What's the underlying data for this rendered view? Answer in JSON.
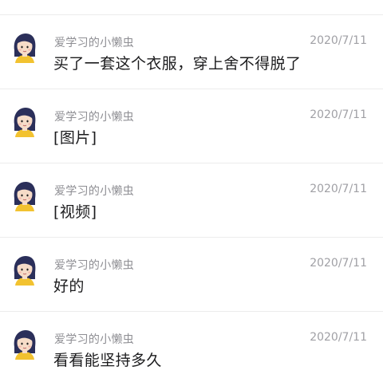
{
  "messages": [
    {
      "sender": "爱学习的小懒虫",
      "time": "2020/7/11",
      "text": "买了一套这个衣服，穿上舍不得脱了",
      "avatar_icon": "girl-avatar-icon"
    },
    {
      "sender": "爱学习的小懒虫",
      "time": "2020/7/11",
      "text": "[图片]",
      "avatar_icon": "girl-avatar-icon"
    },
    {
      "sender": "爱学习的小懒虫",
      "time": "2020/7/11",
      "text": "[视频]",
      "avatar_icon": "girl-avatar-icon"
    },
    {
      "sender": "爱学习的小懒虫",
      "time": "2020/7/11",
      "text": "好的",
      "avatar_icon": "girl-avatar-icon"
    },
    {
      "sender": "爱学习的小懒虫",
      "time": "2020/7/11",
      "text": "看看能坚持多久",
      "avatar_icon": "girl-avatar-icon"
    }
  ],
  "colors": {
    "sender": "#8e8e93",
    "time": "#a0a0a5",
    "text": "#1c1c1e",
    "divider": "#ececec",
    "avatar_hair": "#2b2f5a",
    "avatar_skin": "#f6dcc8",
    "avatar_shirt": "#f2c230"
  }
}
